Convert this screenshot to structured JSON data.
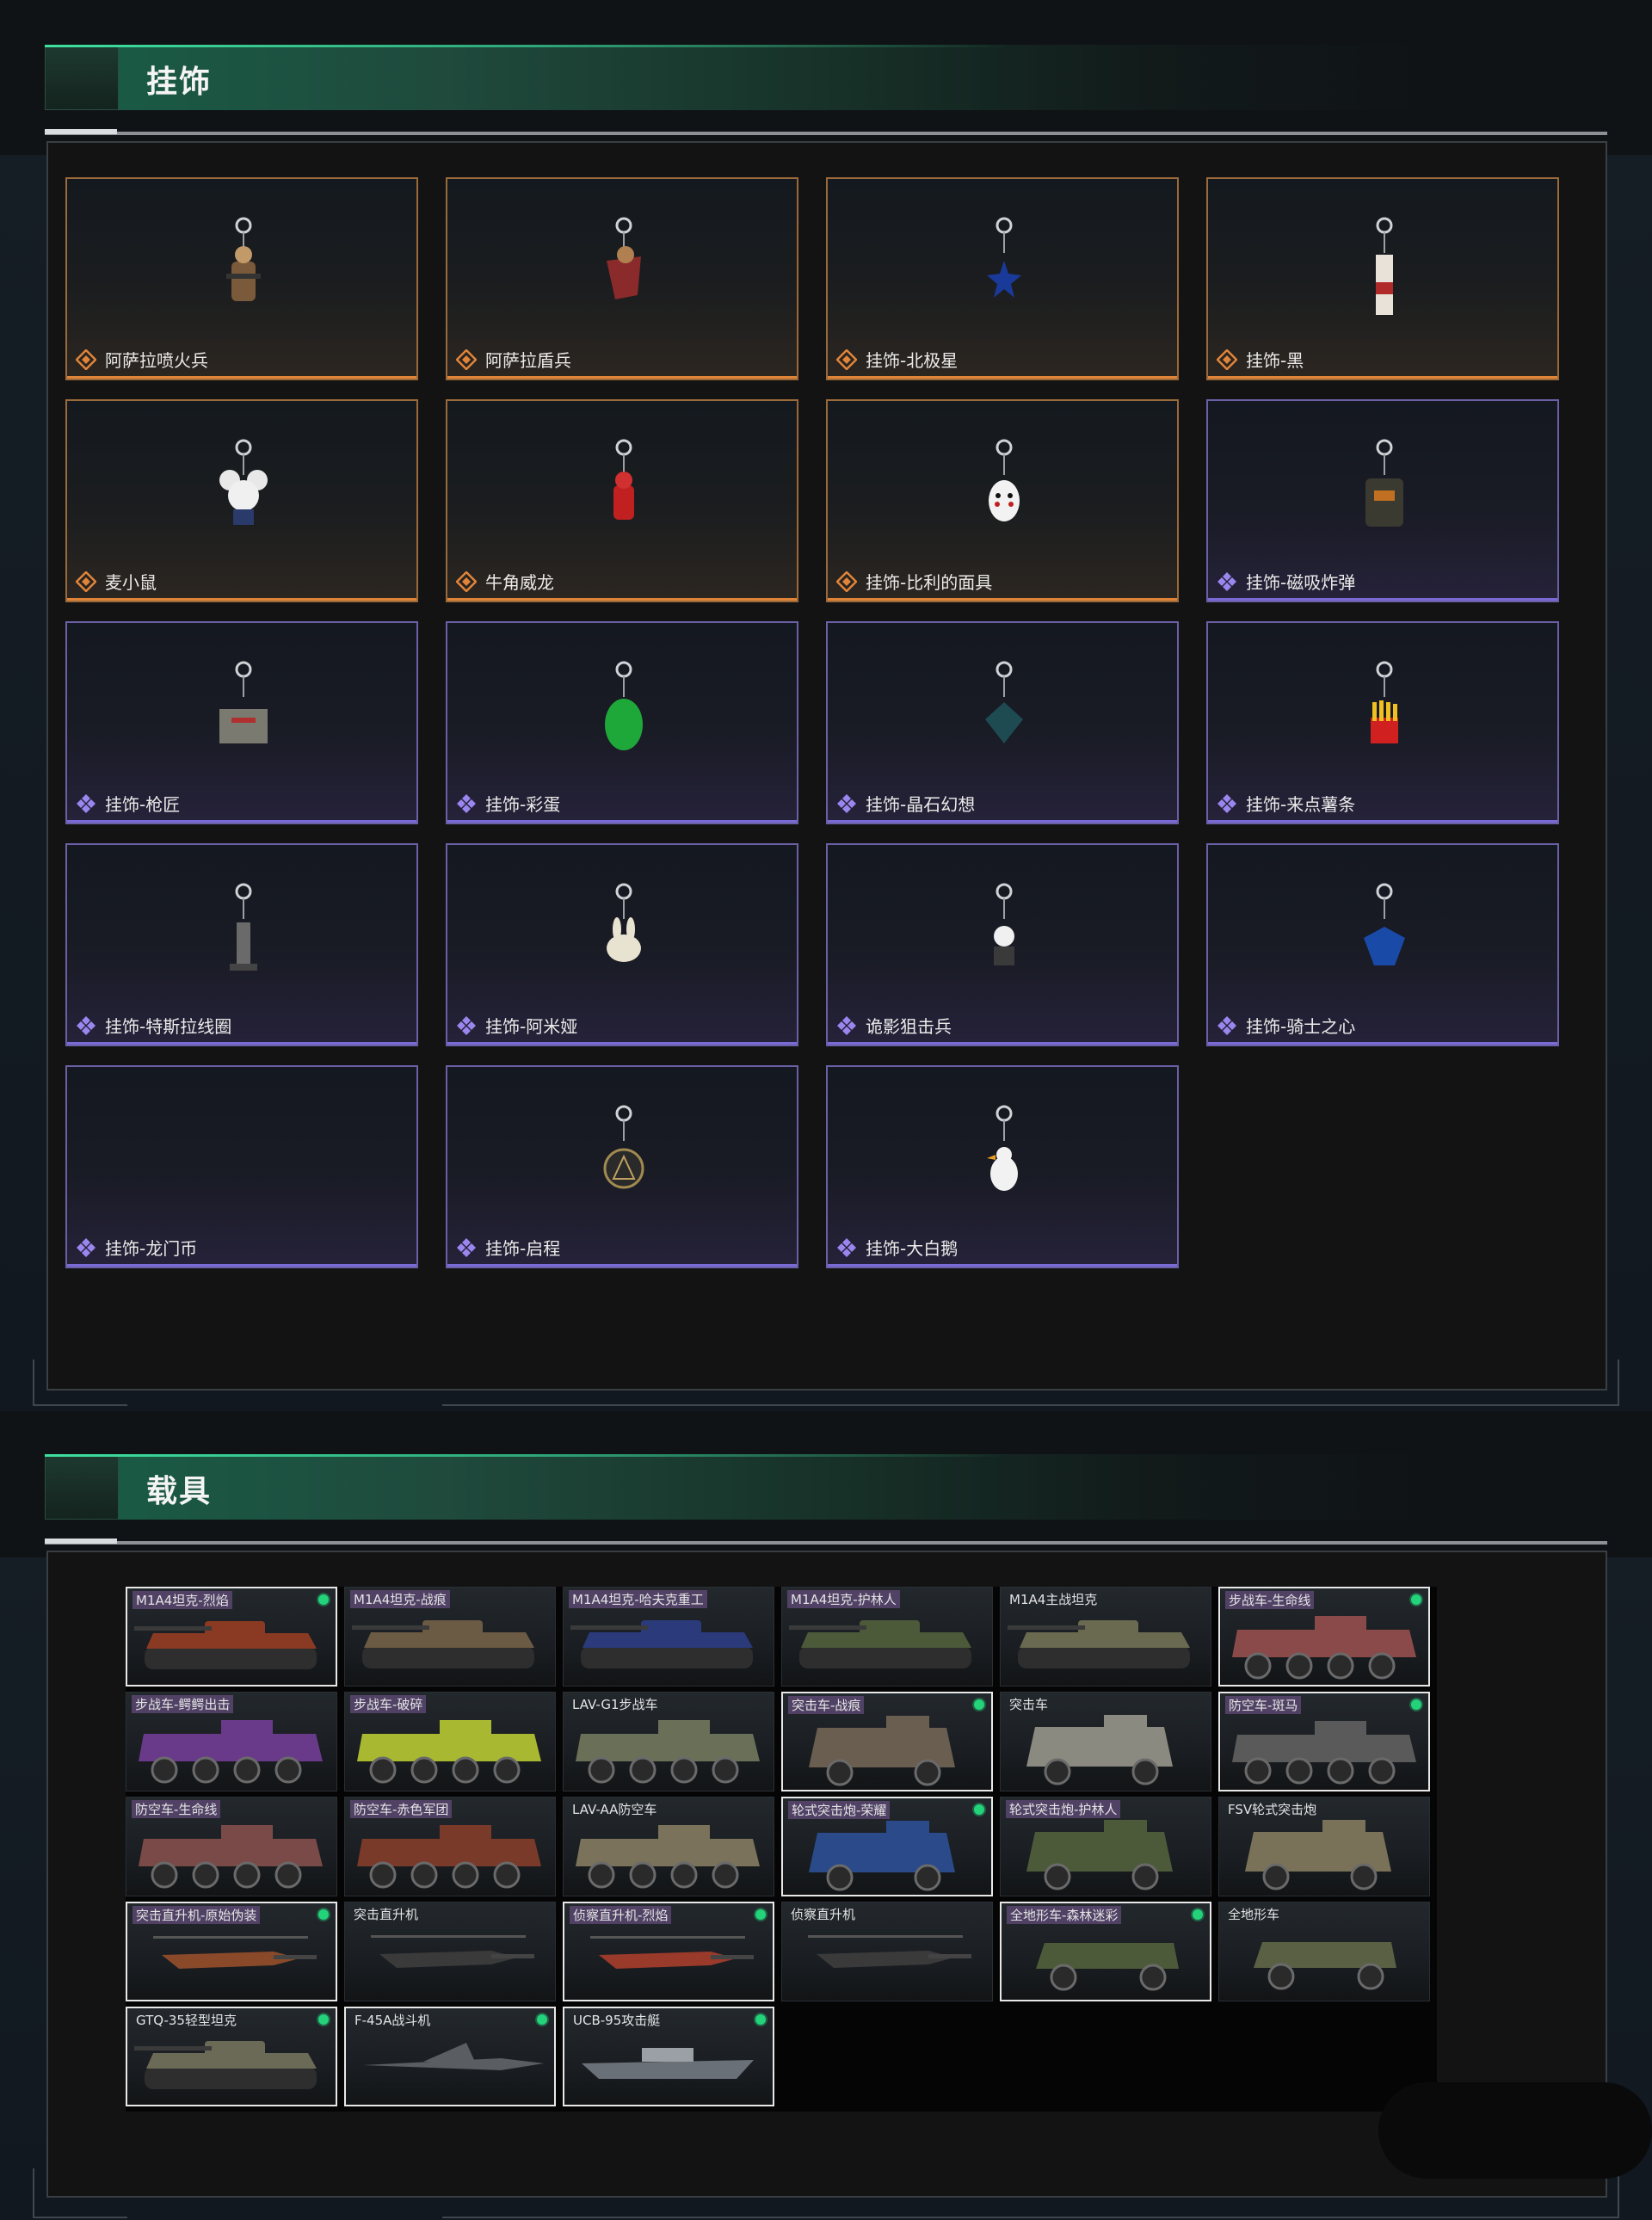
{
  "charms_section": {
    "title": "挂饰",
    "items": [
      {
        "label": "阿萨拉喷火兵",
        "rarity": "orange",
        "icon": "soldier-charm-icon"
      },
      {
        "label": "阿萨拉盾兵",
        "rarity": "orange",
        "icon": "shield-soldier-charm-icon"
      },
      {
        "label": "挂饰-北极星",
        "rarity": "orange",
        "icon": "star-charm-icon"
      },
      {
        "label": "挂饰-黑",
        "rarity": "orange",
        "icon": "tag-charm-icon"
      },
      {
        "label": "麦小鼠",
        "rarity": "orange",
        "icon": "mouse-charm-icon"
      },
      {
        "label": "牛角威龙",
        "rarity": "orange",
        "icon": "horned-figure-charm-icon"
      },
      {
        "label": "挂饰-比利的面具",
        "rarity": "orange",
        "icon": "mask-charm-icon"
      },
      {
        "label": "挂饰-磁吸炸弹",
        "rarity": "purple",
        "icon": "bomb-charm-icon"
      },
      {
        "label": "挂饰-枪匠",
        "rarity": "purple",
        "icon": "gunsmith-charm-icon"
      },
      {
        "label": "挂饰-彩蛋",
        "rarity": "purple",
        "icon": "egg-charm-icon"
      },
      {
        "label": "挂饰-晶石幻想",
        "rarity": "purple",
        "icon": "crystal-charm-icon"
      },
      {
        "label": "挂饰-来点薯条",
        "rarity": "purple",
        "icon": "fries-charm-icon"
      },
      {
        "label": "挂饰-特斯拉线圈",
        "rarity": "purple",
        "icon": "tesla-coil-charm-icon"
      },
      {
        "label": "挂饰-阿米娅",
        "rarity": "purple",
        "icon": "bunny-charm-icon"
      },
      {
        "label": "诡影狙击兵",
        "rarity": "purple",
        "icon": "sniper-charm-icon"
      },
      {
        "label": "挂饰-骑士之心",
        "rarity": "purple",
        "icon": "knight-heart-charm-icon"
      },
      {
        "label": "挂饰-龙门币",
        "rarity": "purple",
        "icon": "coin-charm-icon"
      },
      {
        "label": "挂饰-启程",
        "rarity": "purple",
        "icon": "medallion-charm-icon"
      },
      {
        "label": "挂饰-大白鹅",
        "rarity": "purple",
        "icon": "goose-charm-icon"
      }
    ]
  },
  "vehicles_section": {
    "title": "载具",
    "items": [
      {
        "label": "M1A4坦克-烈焰",
        "kind": "tank",
        "selected": true,
        "owned": true,
        "label_bg": true,
        "paint": "#8a3a22"
      },
      {
        "label": "M1A4坦克-战痕",
        "kind": "tank",
        "selected": false,
        "owned": false,
        "label_bg": true,
        "paint": "#6b5a44"
      },
      {
        "label": "M1A4坦克-哈夫克重工",
        "kind": "tank",
        "selected": false,
        "owned": false,
        "label_bg": true,
        "paint": "#2a3a7a"
      },
      {
        "label": "M1A4坦克-护林人",
        "kind": "tank",
        "selected": false,
        "owned": false,
        "label_bg": true,
        "paint": "#4c5a3a"
      },
      {
        "label": "M1A4主战坦克",
        "kind": "tank",
        "selected": false,
        "owned": false,
        "label_bg": false,
        "paint": "#6a6a50"
      },
      {
        "label": "步战车-生命线",
        "kind": "ifv",
        "selected": true,
        "owned": true,
        "label_bg": true,
        "paint": "#8a4a4a"
      },
      {
        "label": "步战车-鳄鳄出击",
        "kind": "ifv",
        "selected": false,
        "owned": false,
        "label_bg": true,
        "paint": "#6a3a8a"
      },
      {
        "label": "步战车-破碎",
        "kind": "ifv",
        "selected": false,
        "owned": false,
        "label_bg": true,
        "paint": "#a8b830"
      },
      {
        "label": "LAV-G1步战车",
        "kind": "ifv",
        "selected": false,
        "owned": false,
        "label_bg": false,
        "paint": "#6a7058"
      },
      {
        "label": "突击车-战痕",
        "kind": "truck",
        "selected": true,
        "owned": true,
        "label_bg": true,
        "paint": "#6a5e50"
      },
      {
        "label": "突击车",
        "kind": "truck",
        "selected": false,
        "owned": false,
        "label_bg": false,
        "paint": "#8a8a80"
      },
      {
        "label": "防空车-斑马",
        "kind": "ifv",
        "selected": true,
        "owned": true,
        "label_bg": true,
        "paint": "#5a5a5a"
      },
      {
        "label": "防空车-生命线",
        "kind": "ifv",
        "selected": false,
        "owned": false,
        "label_bg": true,
        "paint": "#7a4a48"
      },
      {
        "label": "防空车-赤色军团",
        "kind": "ifv",
        "selected": false,
        "owned": false,
        "label_bg": true,
        "paint": "#7a3a2a"
      },
      {
        "label": "LAV-AA防空车",
        "kind": "ifv",
        "selected": false,
        "owned": false,
        "label_bg": false,
        "paint": "#7a725a"
      },
      {
        "label": "轮式突击炮-荣耀",
        "kind": "truck",
        "selected": true,
        "owned": true,
        "label_bg": true,
        "paint": "#2a4a8a"
      },
      {
        "label": "轮式突击炮-护林人",
        "kind": "truck",
        "selected": false,
        "owned": false,
        "label_bg": true,
        "paint": "#4c5a3a"
      },
      {
        "label": "FSV轮式突击炮",
        "kind": "truck",
        "selected": false,
        "owned": false,
        "label_bg": false,
        "paint": "#7a7258"
      },
      {
        "label": "突击直升机-原始伪装",
        "kind": "heli",
        "selected": true,
        "owned": true,
        "label_bg": true,
        "paint": "#8a4a2a"
      },
      {
        "label": "突击直升机",
        "kind": "heli",
        "selected": false,
        "owned": false,
        "label_bg": false,
        "paint": "#3a3a3a"
      },
      {
        "label": "侦察直升机-烈焰",
        "kind": "heli",
        "selected": true,
        "owned": true,
        "label_bg": true,
        "paint": "#9a3a2a"
      },
      {
        "label": "侦察直升机",
        "kind": "heli",
        "selected": false,
        "owned": false,
        "label_bg": false,
        "paint": "#3a3a3a"
      },
      {
        "label": "全地形车-森林迷彩",
        "kind": "atv",
        "selected": true,
        "owned": true,
        "label_bg": true,
        "paint": "#4c5a3a"
      },
      {
        "label": "全地形车",
        "kind": "atv",
        "selected": false,
        "owned": false,
        "label_bg": false,
        "paint": "#5a6044"
      },
      {
        "label": "GTQ-35轻型坦克",
        "kind": "tank",
        "selected": true,
        "owned": true,
        "label_bg": false,
        "paint": "#6a6a56"
      },
      {
        "label": "F-45A战斗机",
        "kind": "jet",
        "selected": true,
        "owned": true,
        "label_bg": false,
        "paint": "#5a5e62"
      },
      {
        "label": "UCB-95攻击艇",
        "kind": "boat",
        "selected": true,
        "owned": true,
        "label_bg": false,
        "paint": "#6a7078"
      }
    ]
  },
  "colors": {
    "accent_green": "#2fd08a",
    "rarity_orange": "#e0843a",
    "rarity_purple": "#7a6ad6",
    "owned_dot": "#22d37a"
  }
}
